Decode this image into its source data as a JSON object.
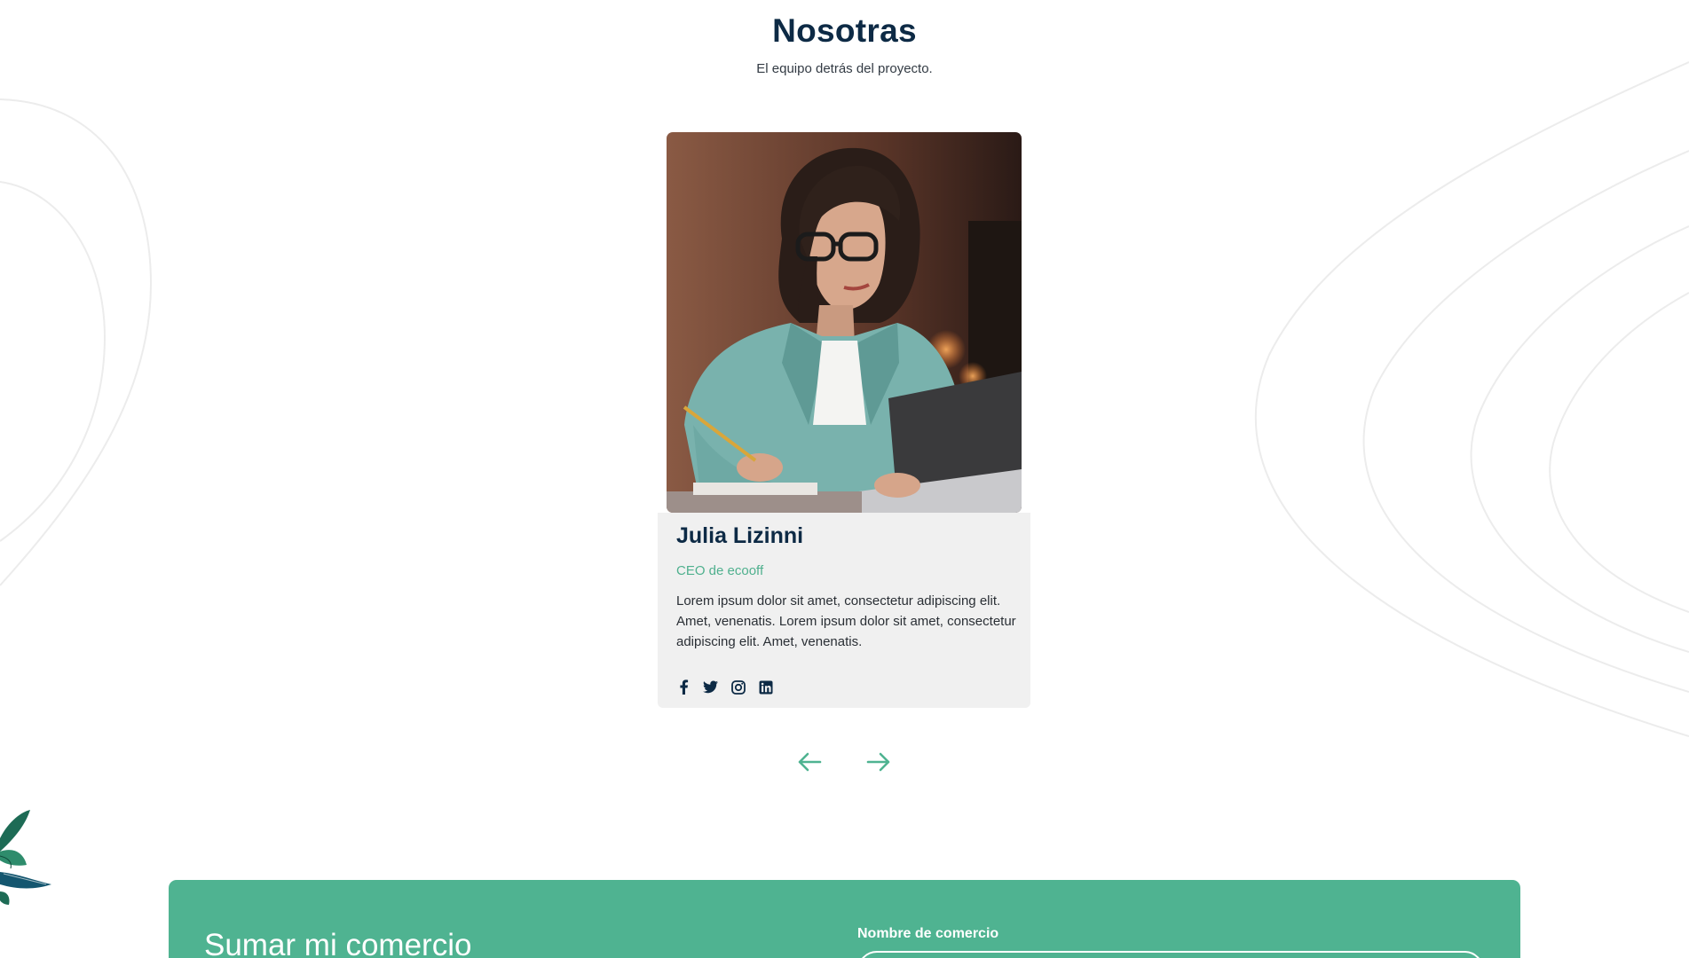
{
  "section": {
    "title": "Nosotras",
    "subtitle": "El equipo detrás del proyecto."
  },
  "member": {
    "name": "Julia Lizinni",
    "role": "CEO de ecooff",
    "bio": "Lorem ipsum dolor sit amet, consectetur adipiscing elit. Amet, venenatis. Lorem ipsum dolor sit amet, consectetur adipiscing elit. Amet, venenatis.",
    "socials": [
      "facebook-icon",
      "twitter-icon",
      "instagram-icon",
      "linkedin-icon"
    ]
  },
  "carousel": {
    "prev_icon": "arrow-left-icon",
    "next_icon": "arrow-right-icon"
  },
  "cta": {
    "title": "Sumar mi comercio",
    "field_label": "Nombre de comercio"
  },
  "colors": {
    "accent": "#4fb391",
    "heading": "#0d2a45",
    "card_bg": "#f0f0f0"
  }
}
